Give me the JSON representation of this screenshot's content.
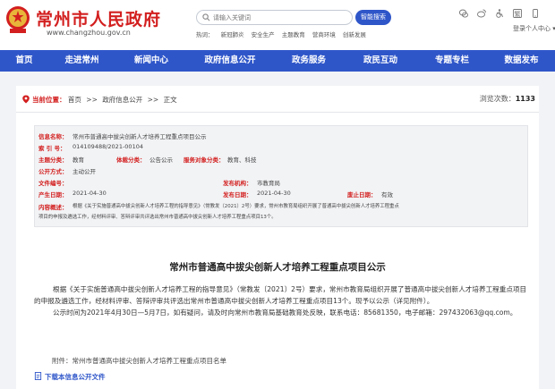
{
  "header": {
    "site_title": "常州市人民政府",
    "site_url": "www.changzhou.gov.cn",
    "search_placeholder": "请输入关键词",
    "search_button": "智能搜索",
    "hot_words": [
      "热词：",
      "新冠肺炎",
      "安全生产",
      "主题教育",
      "营商环境",
      "创新发展"
    ],
    "login_link": "登录个人中心 ▾",
    "util_icons": [
      "wechat-icon",
      "weibo-icon",
      "accessibility-icon",
      "traditional-chinese-icon",
      "mobile-icon"
    ]
  },
  "nav": {
    "items": [
      "首页",
      "走进常州",
      "新闻中心",
      "政府信息公开",
      "政务服务",
      "政民互动",
      "专题专栏",
      "数据发布"
    ]
  },
  "breadcrumb": {
    "label": "当前位置：",
    "items": [
      "首页",
      "政府信息公开",
      "正文"
    ],
    "sep": ">>",
    "views_label": "浏览次数：",
    "views": "1133"
  },
  "meta": {
    "info_name_label": "信息名称：",
    "info_name": "常州市普通高中拔尖创新人才培养工程重点项目公示",
    "index_no_label": "索  引  号：",
    "index_no": "014109488/2021-00104",
    "topic_label": "主题分类：",
    "topic": "教育",
    "genre_label": "体裁分类：",
    "genre": "公告公示",
    "service_label": "服务对象分类：",
    "service": "教育、科技",
    "open_mode_label": "公开方式：",
    "open_mode": "主动公开",
    "doc_no_label": "文件编号：",
    "doc_no": "",
    "issuer_label": "发布机构：",
    "issuer": "市教育局",
    "created_label": "产生日期：",
    "created": "2021-04-30",
    "published_label": "发布日期：",
    "published": "2021-04-30",
    "validity_label": "废止日期：",
    "validity": "有效",
    "summary_label": "内容概述：",
    "summary_line1": "根据《关于实施普通高中拔尖创新人才培养工程的指导意见》（常教发〔2021〕2号）要求，常州市教育局组织开展了普通高中拔尖创新人才培养工程重点",
    "summary_line2": "项目的申报及遴选工作，经材料评审、答辩评审共评选出常州市普通高中拔尖创新人才培养工程重点项目13个。"
  },
  "article": {
    "title": "常州市普通高中拔尖创新人才培养工程重点项目公示",
    "para1": "根据《关于实施普通高中拔尖创新人才培养工程的指导意见》（常教发〔2021〕2号）要求，常州市教育局组织开展了普通高中拔尖创新人才培养工程重点项目的申报及遴选工作，经材料评审、答辩评审共评选出常州市普通高中拔尖创新人才培养工程重点项目13个。现予以公示（详见附件）。",
    "para2": "公示时间为2021年4月30日—5月7日，如有疑问，请及时向常州市教育局基础教育处反映，联系电话：85681350，电子邮箱：297432063@qq.com。",
    "attachment": "附件：常州市普通高中拔尖创新人才培养工程重点项目名单",
    "download_label": "下载本信息公开文件"
  },
  "colors": {
    "brand_red": "#d31f1f",
    "nav_blue": "#2f56c9",
    "page_bg": "#f1f3f6",
    "meta_bg": "#f2f3f5"
  }
}
